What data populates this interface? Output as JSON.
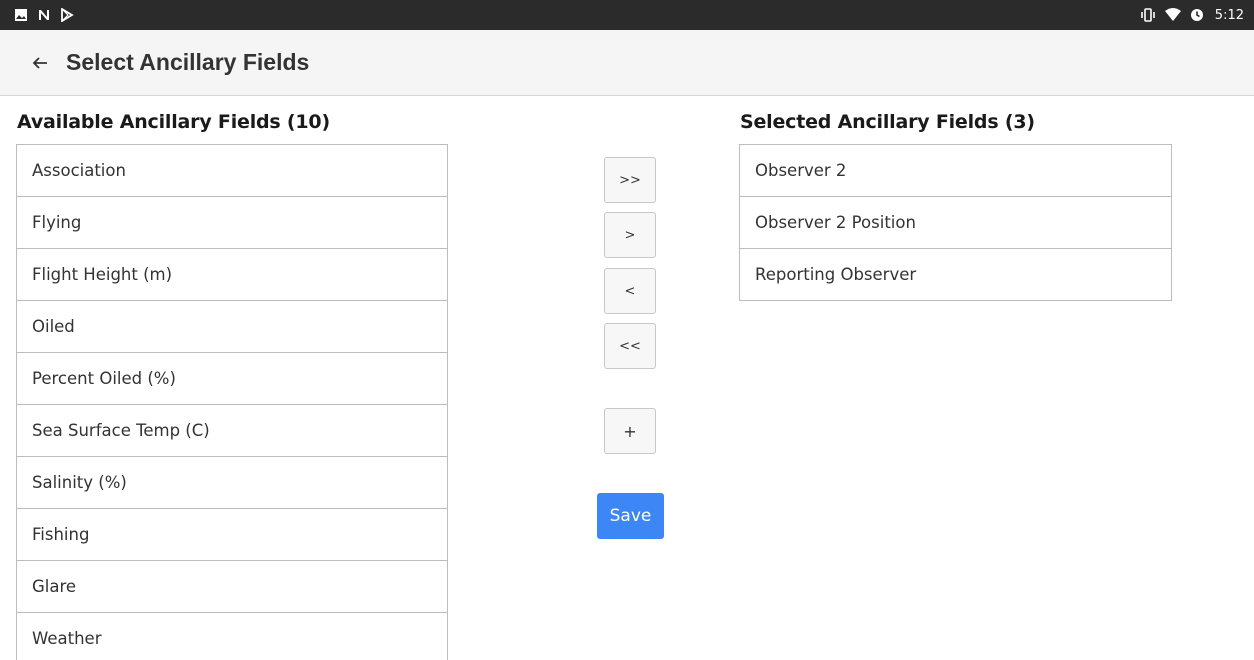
{
  "status_bar": {
    "left_icons": [
      "gallery-icon",
      "n-icon",
      "play-store-icon"
    ],
    "right_icons": [
      "vibrate-icon",
      "wifi-icon",
      "clock-icon"
    ],
    "time": "5:12"
  },
  "app_bar": {
    "back_icon": "arrow-back-icon",
    "title": "Select Ancillary Fields"
  },
  "available": {
    "heading": "Available Ancillary Fields (10)",
    "items": [
      "Association",
      "Flying",
      "Flight Height (m)",
      "Oiled",
      "Percent Oiled (%)",
      "Sea Surface Temp (C)",
      "Salinity (%)",
      "Fishing",
      "Glare",
      "Weather"
    ]
  },
  "selected": {
    "heading": "Selected Ancillary Fields (3)",
    "items": [
      "Observer 2",
      "Observer 2 Position",
      "Reporting Observer"
    ]
  },
  "controls": {
    "move_all_right": ">>",
    "move_right": ">",
    "move_left": "<",
    "move_all_left": "<<",
    "add": "+",
    "save": "Save"
  },
  "colors": {
    "save_button": "#3d86f6",
    "status_bar": "#2b2b2b",
    "app_bar": "#f5f5f5"
  }
}
